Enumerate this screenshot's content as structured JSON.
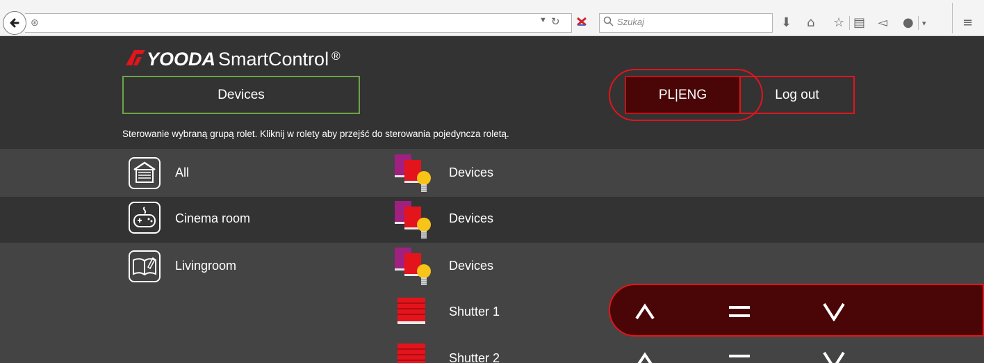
{
  "browser": {
    "search_placeholder": "Szukaj",
    "icons": [
      "back-icon",
      "globe-icon",
      "dropdown-icon",
      "reload-icon",
      "x-icon",
      "search-icon",
      "download-icon",
      "home-icon",
      "star-icon",
      "reader-icon",
      "send-icon",
      "shield-icon",
      "menu-icon"
    ]
  },
  "app": {
    "logo_brand": "YOODA",
    "logo_product": "SmartControl",
    "logo_reg": "®",
    "nav_devices": "Devices",
    "lang_switch": "PL|ENG",
    "logout": "Log out",
    "instruction": "Sterowanie wybraną grupą rolet. Kliknij w rolety aby przejść do sterowania pojedyncza roletą."
  },
  "rooms": [
    {
      "name": "All",
      "icon": "house-icon",
      "device_label": "Devices"
    },
    {
      "name": "Cinema room",
      "icon": "gamepad-icon",
      "device_label": "Devices"
    },
    {
      "name": "Livingroom",
      "icon": "book-icon",
      "device_label": "Devices"
    }
  ],
  "shutters": [
    {
      "name": "Shutter 1",
      "active": true
    },
    {
      "name": "Shutter 2",
      "active": false
    }
  ],
  "colors": {
    "accent_red": "#e3141c",
    "accent_green": "#6ca444",
    "active_bg": "#4a0606",
    "header_bg": "#333333",
    "body_bg": "#444444"
  }
}
